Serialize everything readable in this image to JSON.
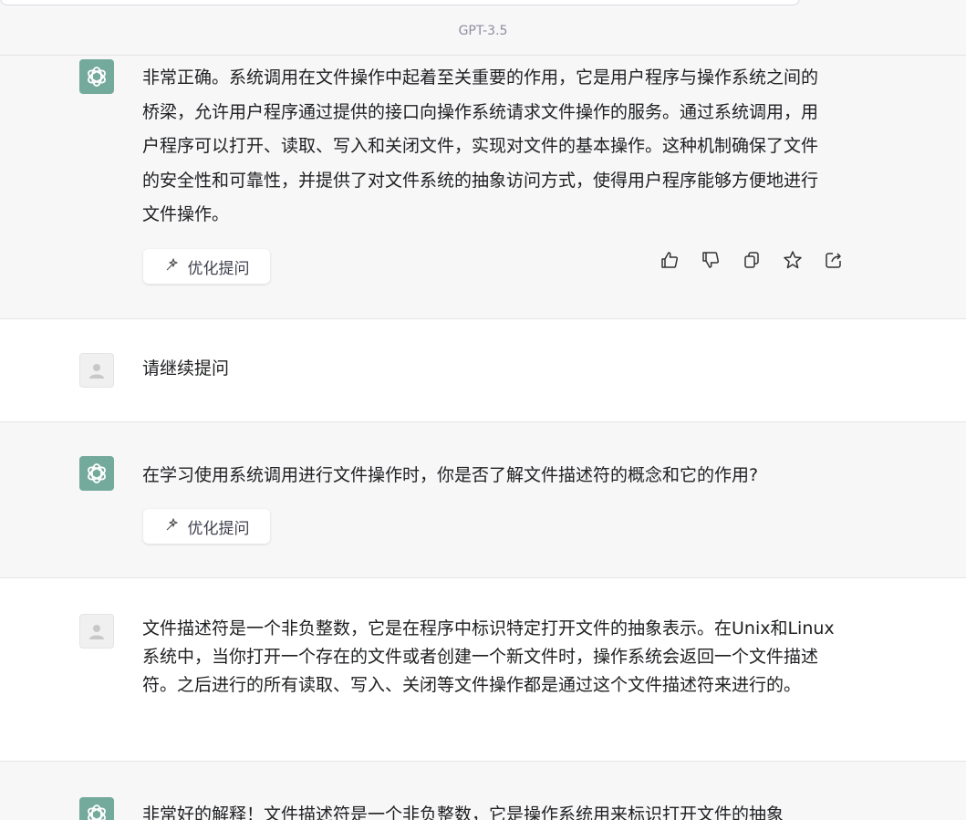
{
  "header": {
    "model_label": "GPT-3.5"
  },
  "messages": [
    {
      "role": "assistant",
      "text": "非常正确。系统调用在文件操作中起着至关重要的作用，它是用户程序与操作系统之间的桥梁，允许用户程序通过提供的接口向操作系统请求文件操作的服务。通过系统调用，用户程序可以打开、读取、写入和关闭文件，实现对文件的基本操作。这种机制确保了文件的安全性和可靠性，并提供了对文件系统的抽象访问方式，使得用户程序能够方便地进行文件操作。",
      "refine_label": "优化提问"
    },
    {
      "role": "user",
      "text": "请继续提问"
    },
    {
      "role": "assistant",
      "text": "在学习使用系统调用进行文件操作时，你是否了解文件描述符的概念和它的作用?",
      "refine_label": "优化提问"
    },
    {
      "role": "user",
      "text": "文件描述符是一个非负整数，它是在程序中标识特定打开文件的抽象表示。在Unix和Linux系统中，当你打开一个存在的文件或者创建一个新文件时，操作系统会返回一个文件描述符。之后进行的所有读取、写入、关闭等文件操作都是通过这个文件描述符来进行的。"
    },
    {
      "role": "assistant",
      "text": "非常好的解释！文件描述符是一个非负整数，它是操作系统用来标识打开文件的抽象"
    }
  ],
  "icons": {
    "assistant_avatar": "openai-logo-icon",
    "user_avatar": "user-silhouette-icon",
    "refine": "magic-wand-icon",
    "actions": [
      "thumbs-up-icon",
      "thumbs-down-icon",
      "copy-icon",
      "star-icon",
      "share-icon"
    ]
  },
  "colors": {
    "assistant_avatar_bg": "#74aa9c",
    "assistant_row_bg": "#f7f7f8"
  }
}
